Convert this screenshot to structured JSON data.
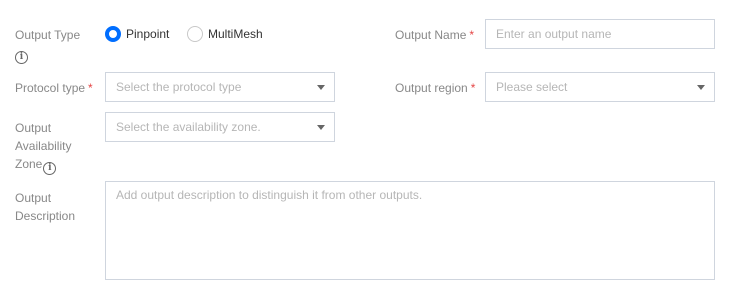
{
  "output_type": {
    "label": "Output Type",
    "info_icon": "info-icon",
    "options": [
      {
        "label": "Pinpoint",
        "selected": true
      },
      {
        "label": "MultiMesh",
        "selected": false
      }
    ]
  },
  "output_name": {
    "label": "Output Name",
    "required_mark": "*",
    "placeholder": "Enter an output name",
    "value": ""
  },
  "protocol_type": {
    "label": "Protocol type",
    "required_mark": "*",
    "placeholder": "Select the protocol type",
    "icon": "caret-down-icon"
  },
  "output_region": {
    "label": "Output region",
    "required_mark": "*",
    "placeholder": "Please select",
    "icon": "caret-down-icon"
  },
  "availability_zone": {
    "label_lines": [
      "Output",
      "Availability",
      "Zone"
    ],
    "info_icon": "info-icon",
    "placeholder": "Select the availability zone.",
    "icon": "caret-down-icon"
  },
  "description": {
    "label_lines": [
      "Output",
      "Description"
    ],
    "placeholder": "Add output description to distinguish it from other outputs.",
    "value": ""
  },
  "colors": {
    "primary": "#006eff",
    "required": "#e54545",
    "label": "#888888",
    "border": "#cfd5de",
    "placeholder": "#b6b6b6"
  }
}
